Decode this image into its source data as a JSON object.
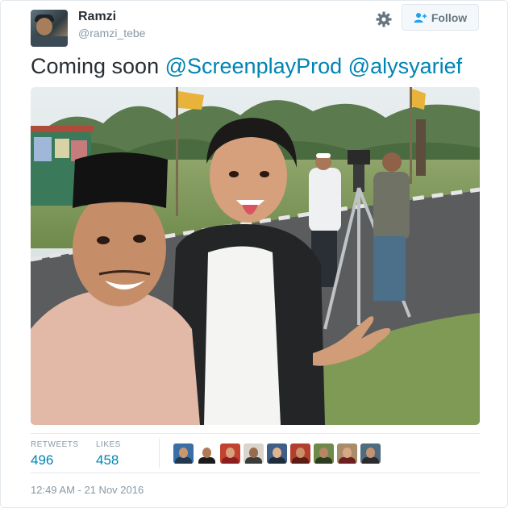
{
  "author": {
    "name": "Ramzi",
    "handle": "@ramzi_tebe"
  },
  "follow_label": "Follow",
  "tweet": {
    "text": "Coming soon",
    "mentions": [
      "@ScreenplayProd",
      "@alysyarief"
    ]
  },
  "stats": {
    "retweets_label": "RETWEETS",
    "retweets_count": "496",
    "likes_label": "LIKES",
    "likes_count": "458"
  },
  "likers": [
    {
      "bg": "#3a6ea5",
      "skin": "#c9966e",
      "shirt": "#22384f"
    },
    {
      "bg": "#ffffff",
      "skin": "#b07a57",
      "shirt": "#1b1b1b"
    },
    {
      "bg": "#c2412f",
      "skin": "#d8a27e",
      "shirt": "#8b1e1e"
    },
    {
      "bg": "#d9d4cc",
      "skin": "#9a6a4c",
      "shirt": "#3b3b3b"
    },
    {
      "bg": "#3f5f86",
      "skin": "#e0b490",
      "shirt": "#1f2c3a"
    },
    {
      "bg": "#b33e2d",
      "skin": "#c98f6a",
      "shirt": "#5a1c14"
    },
    {
      "bg": "#6e8a4a",
      "skin": "#b98463",
      "shirt": "#2d3b21"
    },
    {
      "bg": "#a98d6a",
      "skin": "#d6a984",
      "shirt": "#6b1f1f"
    },
    {
      "bg": "#4f6b7e",
      "skin": "#c59373",
      "shirt": "#2b2b2b"
    }
  ],
  "timestamp": "12:49 AM - 21 Nov 2016",
  "colors": {
    "link": "#0084b4",
    "muted": "#8899a6",
    "border": "#e1e8ed"
  },
  "icons": [
    "settings-gear-icon",
    "follow-person-plus-icon"
  ]
}
